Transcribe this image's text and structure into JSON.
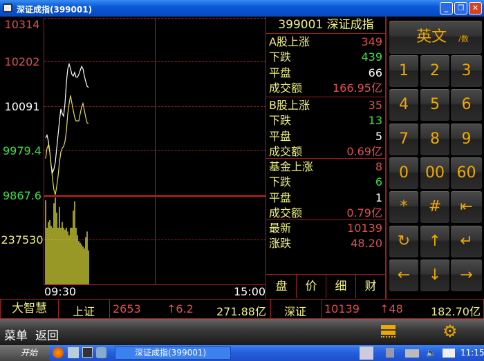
{
  "window": {
    "title": "深证成指(399001)",
    "buttons": [
      "minimize",
      "restore",
      "close"
    ]
  },
  "chart_data": {
    "type": "line",
    "y_ticks": [
      "10314",
      "10202",
      "10091",
      "9979.4",
      "9867.6"
    ],
    "volume_tick": "237530",
    "x_ticks": [
      "09:30",
      "15:00"
    ],
    "ylim": [
      9867.6,
      10314
    ],
    "reference_price": 10091,
    "series": [
      {
        "color": "#ffffff",
        "values": [
          10012,
          10019,
          10003,
          9977,
          9942,
          9925,
          9934,
          9951,
          9986,
          10020,
          10055,
          10085,
          10073,
          10067,
          10099,
          10151,
          10186,
          10198,
          10186,
          10172,
          10168,
          10177,
          10165,
          10165,
          10172,
          10182,
          10192,
          10186,
          10168,
          10154,
          10142,
          10139
        ]
      },
      {
        "color": "#e8e050",
        "values": [
          9960,
          9986,
          9994,
          9977,
          9942,
          9908,
          9881,
          9869,
          9890,
          9916,
          9951,
          9977,
          9986,
          9991,
          10003,
          10029,
          10073,
          10099,
          10119,
          10099,
          10081,
          10064,
          10055,
          10055,
          10055,
          10073,
          10090,
          10099,
          10081,
          10064,
          10050,
          10048
        ]
      }
    ],
    "volume": {
      "color": "#ffff40",
      "values": [
        445000,
        300000,
        330000,
        340000,
        310000,
        300000,
        430000,
        460000,
        380000,
        300000,
        410000,
        300000,
        330000,
        300000,
        290000,
        300000,
        280000,
        260000,
        300000,
        300000,
        390000,
        440000,
        300000,
        260000,
        230000,
        220000,
        210000,
        200000,
        190000,
        250000,
        280000,
        180000
      ]
    }
  },
  "info": {
    "header": "399001  深证成指",
    "sections": [
      [
        {
          "k": "A股上涨",
          "v": "349",
          "c": "#e05050"
        },
        {
          "k": "下跌",
          "v": "439",
          "c": "#40e040"
        },
        {
          "k": "平盘",
          "v": "66",
          "c": "#ffffff"
        },
        {
          "k": "成交额",
          "v": "166.95亿",
          "c": "#e05050"
        }
      ],
      [
        {
          "k": "B股上涨",
          "v": "35",
          "c": "#e05050"
        },
        {
          "k": "下跌",
          "v": "13",
          "c": "#40e040"
        },
        {
          "k": "平盘",
          "v": "5",
          "c": "#ffffff"
        },
        {
          "k": "成交额",
          "v": "0.69亿",
          "c": "#e05050"
        }
      ],
      [
        {
          "k": "基金上涨",
          "v": "8",
          "c": "#e05050"
        },
        {
          "k": "下跌",
          "v": "6",
          "c": "#40e040"
        },
        {
          "k": "平盘",
          "v": "1",
          "c": "#ffffff"
        },
        {
          "k": "成交额",
          "v": "0.79亿",
          "c": "#e05050"
        }
      ],
      [
        {
          "k": "最新",
          "v": "10139",
          "c": "#e05050"
        },
        {
          "k": "涨跌",
          "v": "48.20",
          "c": "#e05050"
        }
      ]
    ],
    "tabs": [
      "盘",
      "价",
      "细",
      "财"
    ]
  },
  "keypad": {
    "mode": "英文",
    "mode_sub": "/数",
    "keys": [
      "1",
      "2",
      "3",
      "4",
      "5",
      "6",
      "7",
      "8",
      "9",
      "0",
      "00",
      "60",
      "*",
      "#",
      "⇤",
      "↻",
      "↑",
      "↵",
      "←",
      "↓",
      "→"
    ]
  },
  "ticker": {
    "brand": "大智慧",
    "sh_label": "上证",
    "sh_price": "2653",
    "sh_change": "↑6.2",
    "sh_amount": "271.88亿",
    "sz_label": "深证",
    "sz_price": "10139",
    "sz_change": "↑48",
    "sz_amount": "182.70亿"
  },
  "menubar": {
    "menu": "菜单",
    "back": "返回"
  },
  "taskbar": {
    "start": "开始",
    "task": "深证成指(399001)",
    "clock": "11:15"
  }
}
